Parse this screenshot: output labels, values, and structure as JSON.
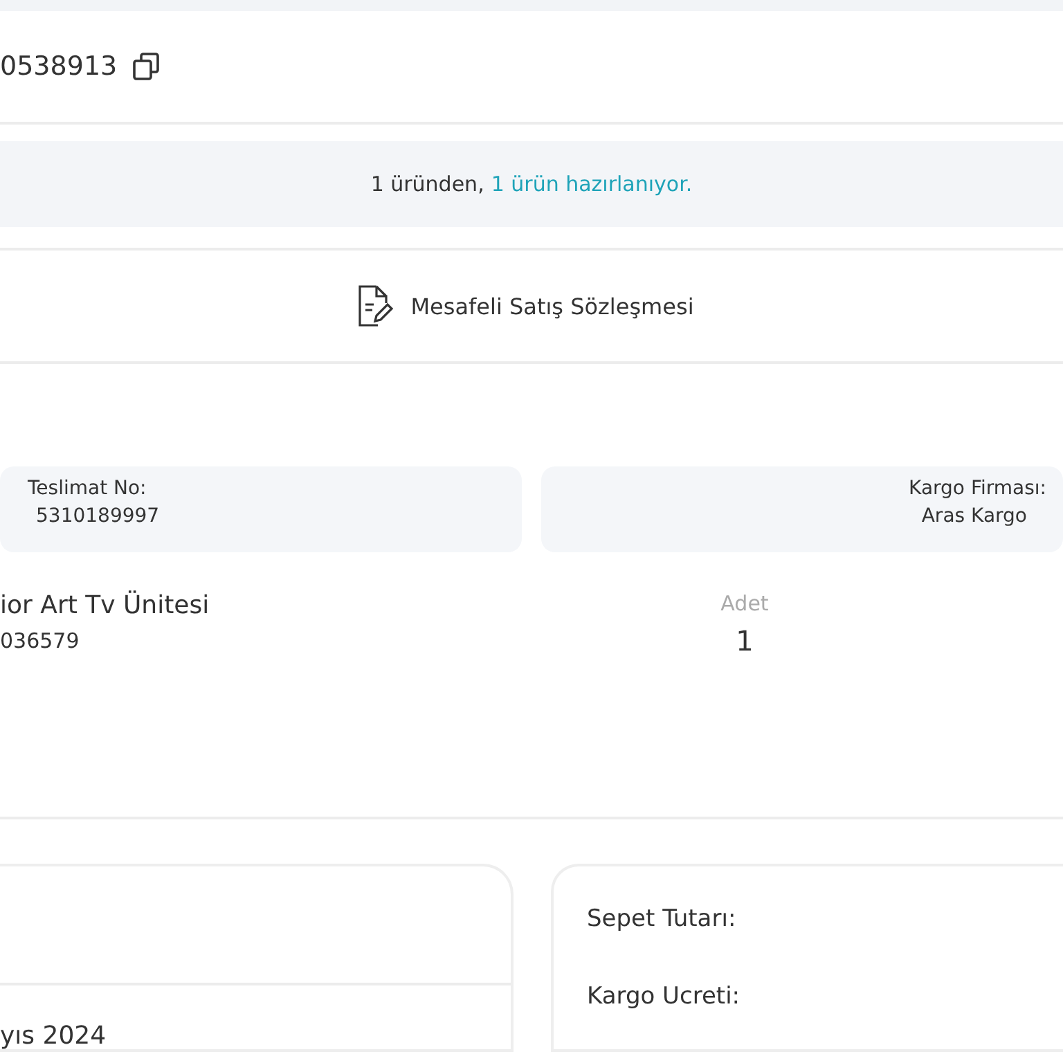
{
  "order": {
    "number": "0538913"
  },
  "notice": {
    "text": "1 üründen,",
    "highlight": "1 ürün hazırlanıyor."
  },
  "contract_link": {
    "label": "Mesafeli Satış Sözleşmesi"
  },
  "shipment_info": [
    {
      "label": "Teslimat No:",
      "value": "5310189997",
      "kind": "start"
    },
    {
      "label": "Kargo Firması:",
      "value": "Aras Kargo",
      "kind": "end"
    }
  ],
  "product": {
    "name": "ior Art Tv Ünitesi",
    "code": "036579",
    "quantity_label": "Adet",
    "quantity": "1"
  },
  "order_card": {
    "date": "yıs 2024"
  },
  "summary": {
    "rows": [
      {
        "label": "Sepet Tutarı:"
      },
      {
        "label": "Kargo Ucreti:"
      }
    ]
  }
}
